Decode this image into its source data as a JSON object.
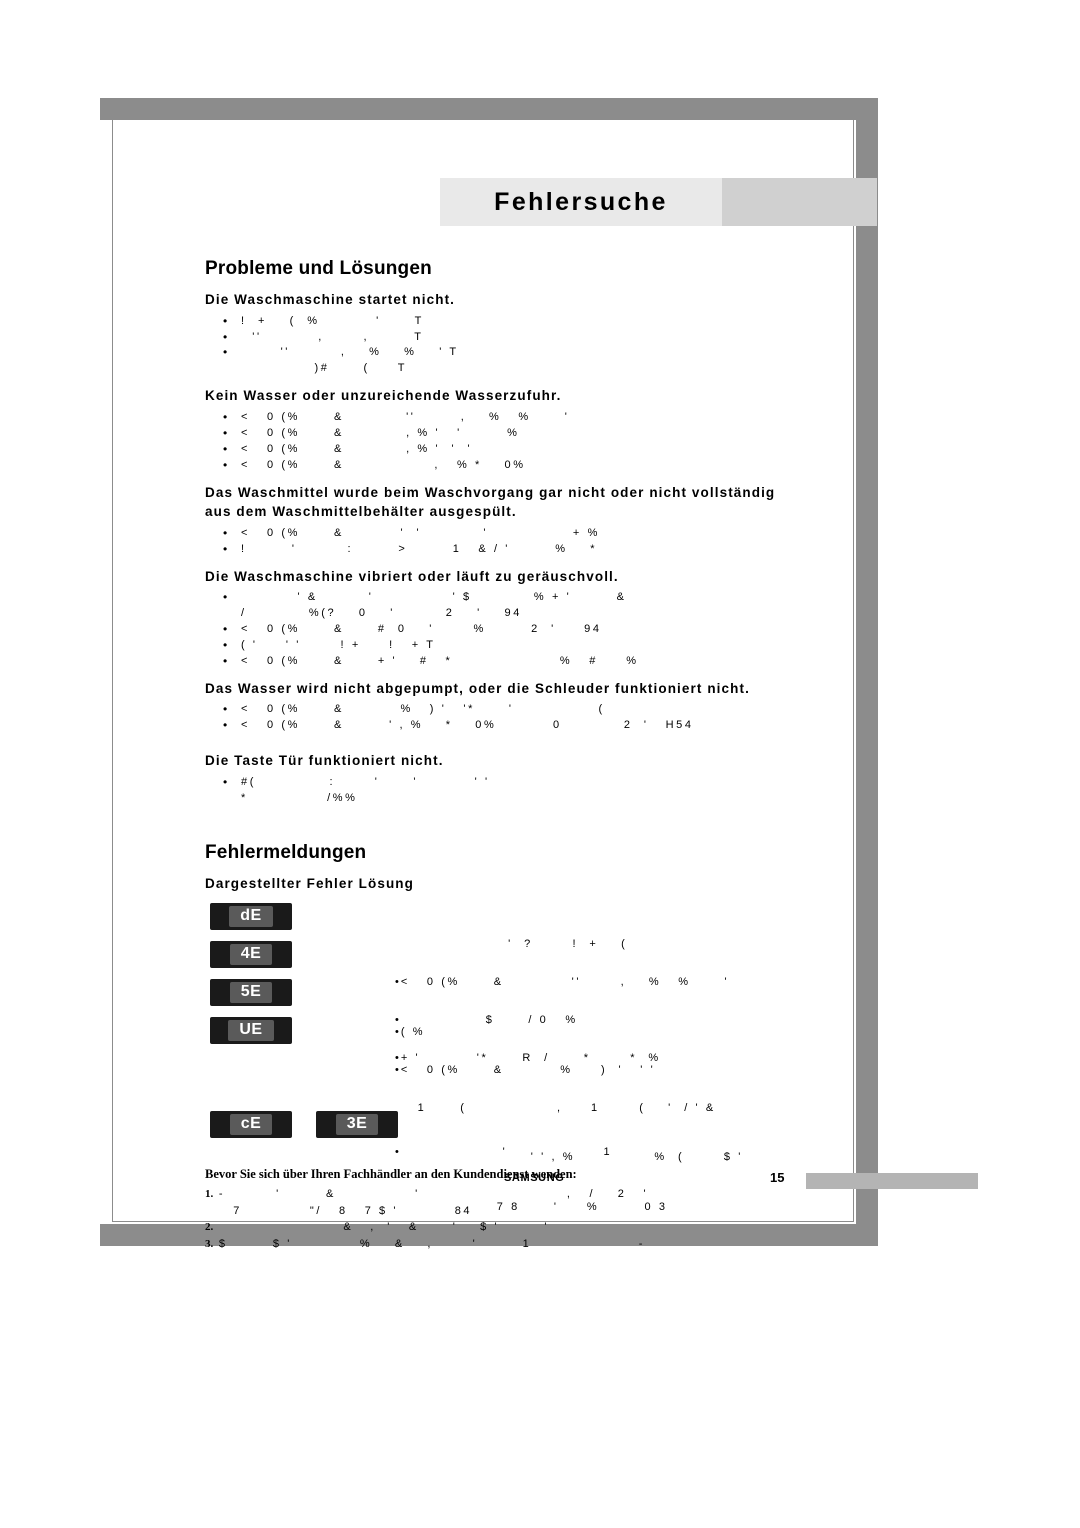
{
  "header": {
    "title": "Fehlersuche"
  },
  "sections": {
    "problems_title": "Probleme und Lösungen",
    "errors_title": "Fehlermeldungen",
    "errors_subtitle": "Dargestellter Fehler Lösung"
  },
  "problems": [
    {
      "heading": "Die Waschmaschine startet nicht.",
      "items": [
        "!  +    (  %          '      T",
        "  ''          ,       ,        T",
        "       ''         ,    %    %    ' T",
        "             )#      (     T"
      ]
    },
    {
      "heading": "Kein Wasser oder unzureichende Wasserzufuhr.",
      "items": [
        "<   0 (%      &           ''        ,    %   %      '",
        "<   0 (%      &           , % '   '        %",
        "<   0 (%      &           , % '  '  '",
        "<   0 (%      &                ,   % *    0%"
      ]
    },
    {
      "heading": "Das Waschmittel wurde beim Waschvorgang gar nicht oder nicht vollständig aus dem Waschmittelbehälter ausgespült.",
      "items": [
        "<   0 (%      &          '  '           '               + %",
        "!        '         :        >        1   & / '        %    *"
      ]
    },
    {
      "heading": "Die Waschmaschine vibriert oder läuft zu geräuschvoll.",
      "items": [
        "          ' &         '              ' $           % + '        &",
        "/           %(?    0    '         2    '    94",
        "<   0 (%      &      #  0    '       %        2  '     94",
        "( '     ' '       ! +     !   + T",
        "<   0 (%      &      + '    #   *                   %   #     %"
      ],
      "continuation_index": 0
    },
    {
      "heading": "Das Wasser wird nicht abgepumpt, oder die Schleuder funktioniert nicht.",
      "items": [
        "<   0 (%      &          %   ) '   '*      '               (",
        "<   0 (%      &        ' , %    *    0%          0           2  '   H54"
      ]
    },
    {
      "heading": "Die Taste Tür funktioniert nicht.",
      "items": [
        "#(             :       '      '          ' '",
        "*              /%%"
      ]
    }
  ],
  "error_rows": [
    {
      "codes": [
        "dE"
      ],
      "lines": [
        "                    '  ?       !  +    ("
      ]
    },
    {
      "codes": [
        "4E"
      ],
      "lines": [
        "<   0 (%      &            ''       ,    %   %      '",
        "( %"
      ]
    },
    {
      "codes": [
        "5E"
      ],
      "lines": [
        "               $      / 0   %",
        "<   0 (%      &          %     )  '   ' '"
      ]
    },
    {
      "codes": [
        "UE"
      ],
      "lines": [
        "+ '          '*      R  /      *       *  %",
        "    1      (                ,     1       (    '  / ' &",
        "                        ' ' , %              %  (       $ '",
        "                  7 8      '     %        0 3"
      ]
    },
    {
      "codes": [
        "cE",
        "3E"
      ],
      "lines": [
        "                  '                 1"
      ]
    }
  ],
  "footer_note": {
    "title": "Bevor Sie sich über Ihren Fachhändler an den Kundendienst wenden:",
    "lines": [
      {
        "num": "1.",
        "text": " -         '        &              '                          ,   /    2   '"
      },
      {
        "num": "",
        "text": "     7            \"/   8   7 $ '          84"
      },
      {
        "num": "2.",
        "text": "                       &   ,  '   &      '    $ '        '"
      },
      {
        "num": "3.",
        "text": " $        $ '            %    &    ,       '        1                   -"
      }
    ]
  },
  "footer": {
    "brand": "SAMSUNG",
    "page": "15"
  }
}
